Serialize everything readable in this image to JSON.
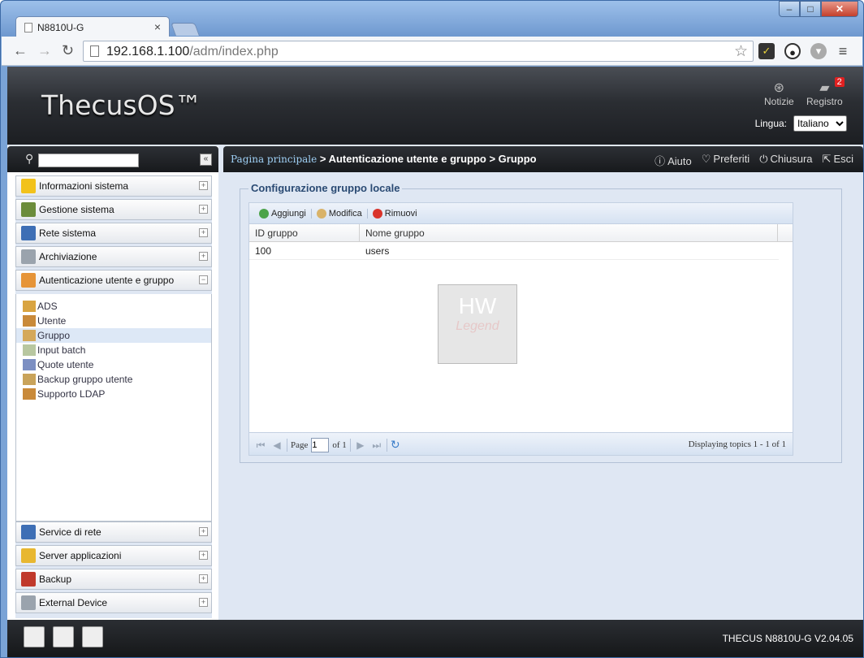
{
  "browser": {
    "tab_title": "N8810U-G",
    "tab_close": "×",
    "url_host": "192.168.1.100",
    "url_path": "/adm/index.php"
  },
  "app": {
    "logo": "ThecusOS™",
    "header": {
      "news_label": "Notizie",
      "log_label": "Registro",
      "log_badge": "2",
      "lang_label": "Lingua:",
      "lang_value": "Italiano"
    },
    "sidebar": {
      "collapse_label": "«",
      "categories_top": [
        {
          "label": "Informazioni sistema",
          "color": "#f2c21b"
        },
        {
          "label": "Gestione sistema",
          "color": "#6b8c3a"
        },
        {
          "label": "Rete sistema",
          "color": "#3e6fb5"
        },
        {
          "label": "Archiviazione",
          "color": "#9aa3ad"
        },
        {
          "label": "Autenticazione utente e gruppo",
          "color": "#e69437"
        }
      ],
      "sub_items": [
        {
          "label": "ADS"
        },
        {
          "label": "Utente"
        },
        {
          "label": "Gruppo"
        },
        {
          "label": "Input batch"
        },
        {
          "label": "Quote utente"
        },
        {
          "label": "Backup gruppo utente"
        },
        {
          "label": "Supporto LDAP"
        }
      ],
      "categories_bottom": [
        {
          "label": "Service di rete",
          "color": "#3e6fb5"
        },
        {
          "label": "Server applicazioni",
          "color": "#e8b730"
        },
        {
          "label": "Backup",
          "color": "#c0392b"
        },
        {
          "label": "External Device",
          "color": "#9aa3ad"
        }
      ]
    },
    "breadcrumb": {
      "home": "Pagina principale",
      "path": " > Autenticazione utente e gruppo > Gruppo"
    },
    "actions": {
      "help": "Aiuto",
      "favorites": "Preferiti",
      "shutdown": "Chiusura",
      "logout": "Esci"
    },
    "panel": {
      "legend": "Configurazione gruppo locale",
      "add": "Aggiungi",
      "edit": "Modifica",
      "remove": "Rimuovi",
      "columns": [
        "ID gruppo",
        "Nome gruppo"
      ],
      "rows": [
        {
          "id": "100",
          "name": "users"
        }
      ],
      "pager": {
        "page_label": "Page",
        "page_value": "1",
        "of_label": "of 1",
        "display": "Displaying topics 1 - 1 of 1"
      }
    },
    "footer": {
      "version": "THECUS N8810U-G V2.04.05"
    }
  }
}
